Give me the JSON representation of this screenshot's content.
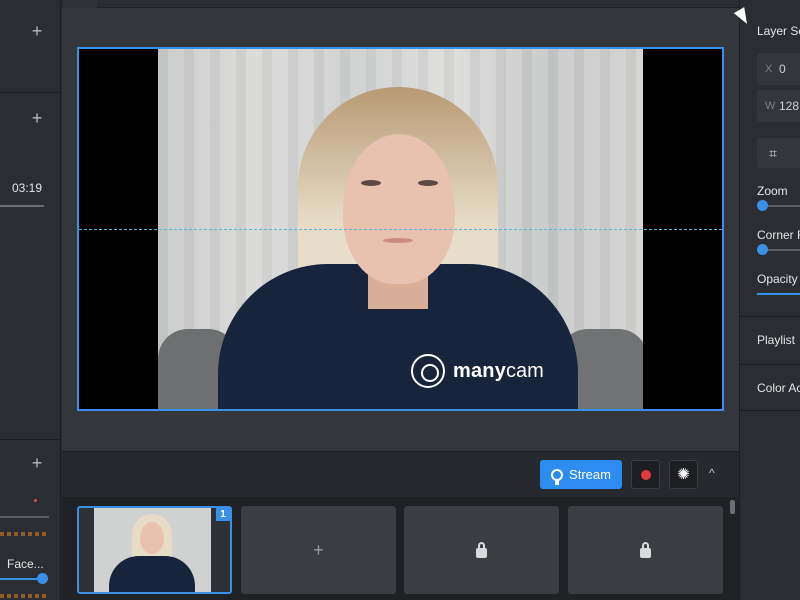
{
  "left_panel": {
    "add_icon_1": "+",
    "add_icon_2": "+",
    "add_icon_3": "+",
    "time": "03:19",
    "face_label": "Face..."
  },
  "preview": {
    "brand_bold": "many",
    "brand_light": "cam"
  },
  "toolbar": {
    "stream_label": "Stream",
    "expand_glyph": "^"
  },
  "presets": {
    "items": [
      {
        "badge": "1",
        "type": "active"
      },
      {
        "type": "add",
        "glyph": "+"
      },
      {
        "type": "locked"
      },
      {
        "type": "locked"
      }
    ]
  },
  "right_panel": {
    "layer_settings": "Layer Se",
    "x_key": "X",
    "x_value": "0",
    "w_key": "W",
    "w_value": "128",
    "crop_glyph": "⌗",
    "zoom_label": "Zoom",
    "corner_label": "Corner R",
    "opacity_label": "Opacity",
    "playlist_label": "Playlist",
    "color_label": "Color Ac"
  },
  "colors": {
    "accent": "#3a8fe8",
    "record": "#e23b3b",
    "panel": "#2a2d31"
  }
}
